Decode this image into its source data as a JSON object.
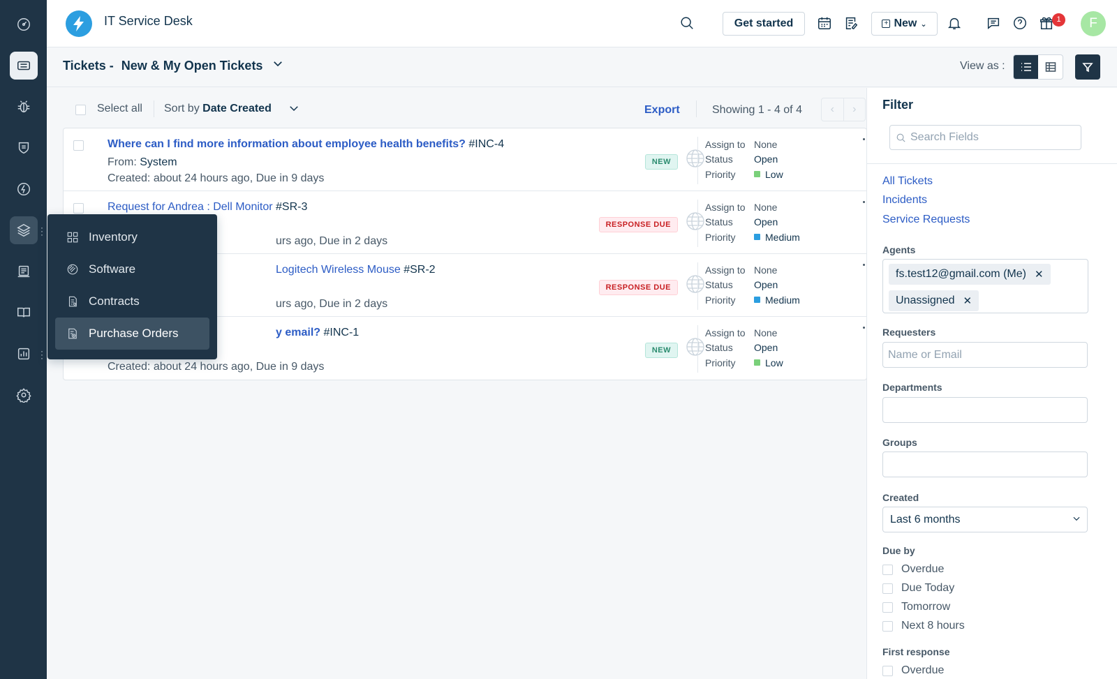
{
  "app": {
    "title": "IT Service Desk"
  },
  "rail": [
    {
      "name": "dashboard-icon"
    },
    {
      "name": "tickets-icon",
      "active": true
    },
    {
      "name": "problems-icon"
    },
    {
      "name": "changes-icon"
    },
    {
      "name": "releases-icon"
    },
    {
      "name": "assets-icon",
      "hover": true
    },
    {
      "name": "solutions-icon"
    },
    {
      "name": "knowledge-icon"
    },
    {
      "name": "reports-icon"
    },
    {
      "name": "settings-icon"
    }
  ],
  "topbar": {
    "get_started": "Get started",
    "new_label": "New",
    "notif_count": "1",
    "avatar_initial": "F"
  },
  "subbar": {
    "title_prefix": "Tickets -",
    "title_view": "New & My Open Tickets",
    "view_as": "View as :"
  },
  "list_toolbar": {
    "select_all": "Select all",
    "sort_prefix": "Sort by",
    "sort_field": "Date Created",
    "export": "Export",
    "showing": "Showing 1 - 4 of 4"
  },
  "ticket_meta_labels": {
    "assign": "Assign to",
    "status": "Status",
    "priority": "Priority"
  },
  "tickets": [
    {
      "subject": "Where can I find more information about employee health benefits?",
      "id": "#INC-4",
      "from_label": "From:",
      "from": "System",
      "created": "Created: about 24 hours ago, Due in 9 days",
      "badge": "NEW",
      "badge_type": "new",
      "assign": "None",
      "status": "Open",
      "priority": "Low",
      "priority_color": "#7ad07a",
      "bold": true
    },
    {
      "subject": "Request for Andrea : Dell Monitor",
      "id": "#SR-3",
      "from_label": "",
      "from": "",
      "created": "urs ago, Due in 2 days",
      "badge": "RESPONSE DUE",
      "badge_type": "due",
      "assign": "None",
      "status": "Open",
      "priority": "Medium",
      "priority_color": "#2c9ee0",
      "bold": false
    },
    {
      "subject": "Logitech Wireless Mouse",
      "id": "#SR-2",
      "from_label": "",
      "from": "",
      "created": "urs ago, Due in 2 days",
      "badge": "RESPONSE DUE",
      "badge_type": "due",
      "assign": "None",
      "status": "Open",
      "priority": "Medium",
      "priority_color": "#2c9ee0",
      "bold": false
    },
    {
      "subject": "y email?",
      "id": "#INC-1",
      "from_label": "",
      "from": "",
      "created": "Created: about 24 hours ago, Due in 9 days",
      "badge": "NEW",
      "badge_type": "new",
      "assign": "None",
      "status": "Open",
      "priority": "Low",
      "priority_color": "#7ad07a",
      "bold": true
    }
  ],
  "flyout": [
    {
      "label": "Inventory",
      "icon": "grid-icon"
    },
    {
      "label": "Software",
      "icon": "software-icon"
    },
    {
      "label": "Contracts",
      "icon": "contract-icon"
    },
    {
      "label": "Purchase Orders",
      "icon": "purchase-order-icon",
      "active": true
    }
  ],
  "filter": {
    "title": "Filter",
    "search_placeholder": "Search Fields",
    "links": [
      "All Tickets",
      "Incidents",
      "Service Requests"
    ],
    "agents_label": "Agents",
    "agents": [
      "fs.test12@gmail.com (Me)",
      "Unassigned"
    ],
    "requesters_label": "Requesters",
    "requesters_placeholder": "Name or Email",
    "departments_label": "Departments",
    "groups_label": "Groups",
    "created_label": "Created",
    "created_value": "Last 6 months",
    "dueby_label": "Due by",
    "dueby_options": [
      "Overdue",
      "Due Today",
      "Tomorrow",
      "Next 8 hours"
    ],
    "first_response_label": "First response",
    "first_response_options": [
      "Overdue"
    ]
  }
}
